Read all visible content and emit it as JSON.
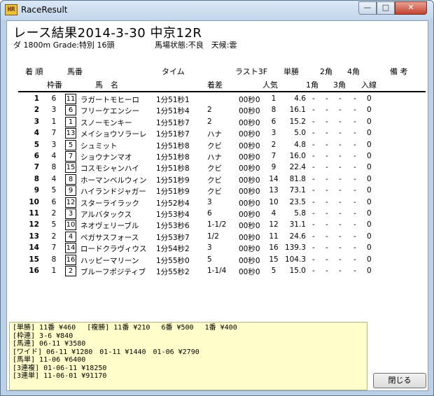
{
  "window": {
    "title": "RaceResult",
    "icon_text": "HR",
    "min_glyph": "—",
    "max_glyph": "□",
    "close_glyph": "✕"
  },
  "race": {
    "title": "レース結果2014-3-30 中京12R",
    "info": "ダ 1800m Grade:特別 16頭",
    "conditions": "馬場状態:不良　天候:雲"
  },
  "headers": {
    "rank": "着 順",
    "uma_top": "馬番",
    "time": "タイム",
    "last3f": "ラスト3F",
    "odds": "単勝",
    "k2": "2角",
    "k4": "4角",
    "note": "備 考",
    "waku": "枠番",
    "name": "馬　名",
    "diff": "着差",
    "pop": "人気",
    "k1": "1角",
    "k3": "3角",
    "entry": "入線"
  },
  "rows": [
    {
      "rank": "1",
      "waku": "6",
      "uma": "11",
      "name": "ラガートモヒーロ",
      "time": "1分51秒1",
      "diff": "",
      "l3f": "00秒0",
      "pop": "1",
      "odds": "4.6",
      "k1": "-",
      "k2": "-",
      "k3": "-",
      "k4": "-",
      "ent": "0"
    },
    {
      "rank": "2",
      "waku": "3",
      "uma": "6",
      "name": "フリーケエンシー",
      "time": "1分51秒4",
      "diff": "2",
      "l3f": "00秒0",
      "pop": "8",
      "odds": "16.1",
      "k1": "-",
      "k2": "-",
      "k3": "-",
      "k4": "-",
      "ent": "0"
    },
    {
      "rank": "3",
      "waku": "1",
      "uma": "1",
      "name": "スノーモンキー",
      "time": "1分51秒7",
      "diff": "2",
      "l3f": "00秒0",
      "pop": "6",
      "odds": "15.2",
      "k1": "-",
      "k2": "-",
      "k3": "-",
      "k4": "-",
      "ent": "0"
    },
    {
      "rank": "4",
      "waku": "7",
      "uma": "13",
      "name": "メイショウソラーレ",
      "time": "1分51秒7",
      "diff": "ハナ",
      "l3f": "00秒0",
      "pop": "3",
      "odds": "5.0",
      "k1": "-",
      "k2": "-",
      "k3": "-",
      "k4": "-",
      "ent": "0"
    },
    {
      "rank": "5",
      "waku": "3",
      "uma": "5",
      "name": "シュミット",
      "time": "1分51秒8",
      "diff": "クビ",
      "l3f": "00秒0",
      "pop": "2",
      "odds": "4.8",
      "k1": "-",
      "k2": "-",
      "k3": "-",
      "k4": "-",
      "ent": "0"
    },
    {
      "rank": "6",
      "waku": "4",
      "uma": "7",
      "name": "ショウナンマオ",
      "time": "1分51秒8",
      "diff": "ハナ",
      "l3f": "00秒0",
      "pop": "7",
      "odds": "16.0",
      "k1": "-",
      "k2": "-",
      "k3": "-",
      "k4": "-",
      "ent": "0"
    },
    {
      "rank": "7",
      "waku": "8",
      "uma": "15",
      "name": "コスモシャンハイ",
      "time": "1分51秒8",
      "diff": "クビ",
      "l3f": "00秒0",
      "pop": "9",
      "odds": "22.4",
      "k1": "-",
      "k2": "-",
      "k3": "-",
      "k4": "-",
      "ent": "0"
    },
    {
      "rank": "8",
      "waku": "4",
      "uma": "8",
      "name": "ホーマンベルウィン",
      "time": "1分51秒9",
      "diff": "クビ",
      "l3f": "00秒0",
      "pop": "14",
      "odds": "81.8",
      "k1": "-",
      "k2": "-",
      "k3": "-",
      "k4": "-",
      "ent": "0"
    },
    {
      "rank": "9",
      "waku": "5",
      "uma": "9",
      "name": "ハイランドジャガー",
      "time": "1分51秒9",
      "diff": "クビ",
      "l3f": "00秒0",
      "pop": "13",
      "odds": "73.1",
      "k1": "-",
      "k2": "-",
      "k3": "-",
      "k4": "-",
      "ent": "0"
    },
    {
      "rank": "10",
      "waku": "6",
      "uma": "12",
      "name": "スターライラック",
      "time": "1分52秒4",
      "diff": "3",
      "l3f": "00秒0",
      "pop": "10",
      "odds": "23.5",
      "k1": "-",
      "k2": "-",
      "k3": "-",
      "k4": "-",
      "ent": "0"
    },
    {
      "rank": "11",
      "waku": "2",
      "uma": "3",
      "name": "アルバタックス",
      "time": "1分53秒4",
      "diff": "6",
      "l3f": "00秒0",
      "pop": "4",
      "odds": "5.8",
      "k1": "-",
      "k2": "-",
      "k3": "-",
      "k4": "-",
      "ent": "0"
    },
    {
      "rank": "12",
      "waku": "5",
      "uma": "10",
      "name": "ネオヴェリーブル",
      "time": "1分53秒6",
      "diff": "1-1/2",
      "l3f": "00秒0",
      "pop": "12",
      "odds": "31.1",
      "k1": "-",
      "k2": "-",
      "k3": "-",
      "k4": "-",
      "ent": "0"
    },
    {
      "rank": "13",
      "waku": "2",
      "uma": "4",
      "name": "ペガサスフォース",
      "time": "1分53秒7",
      "diff": "1/2",
      "l3f": "00秒0",
      "pop": "11",
      "odds": "24.6",
      "k1": "-",
      "k2": "-",
      "k3": "-",
      "k4": "-",
      "ent": "0"
    },
    {
      "rank": "14",
      "waku": "7",
      "uma": "14",
      "name": "ロードクラヴィウス",
      "time": "1分54秒2",
      "diff": "3",
      "l3f": "00秒0",
      "pop": "16",
      "odds": "139.3",
      "k1": "-",
      "k2": "-",
      "k3": "-",
      "k4": "-",
      "ent": "0"
    },
    {
      "rank": "15",
      "waku": "8",
      "uma": "16",
      "name": "ハッピーマリーン",
      "time": "1分55秒0",
      "diff": "5",
      "l3f": "00秒0",
      "pop": "15",
      "odds": "104.3",
      "k1": "-",
      "k2": "-",
      "k3": "-",
      "k4": "-",
      "ent": "0"
    },
    {
      "rank": "16",
      "waku": "1",
      "uma": "2",
      "name": "ブルーフポジティブ",
      "time": "1分55秒2",
      "diff": "1-1/4",
      "l3f": "00秒0",
      "pop": "5",
      "odds": "15.0",
      "k1": "-",
      "k2": "-",
      "k3": "-",
      "k4": "-",
      "ent": "0"
    }
  ],
  "payouts": [
    "[単勝] 11番 ¥460　 [複勝] 11番 ¥210　 6番 ¥500　 1番 ¥400",
    "[枠連] 3-6 ¥840",
    "[馬連] 06-11 ¥3580",
    "[ワイド] 06-11 ¥1280　01-11 ¥1440　01-06 ¥2790",
    "[馬単] 11-06 ¥6400",
    "[3連複] 01-06-11 ¥18250",
    "[3連単] 11-06-01 ¥91170"
  ],
  "close_button": "閉じる"
}
